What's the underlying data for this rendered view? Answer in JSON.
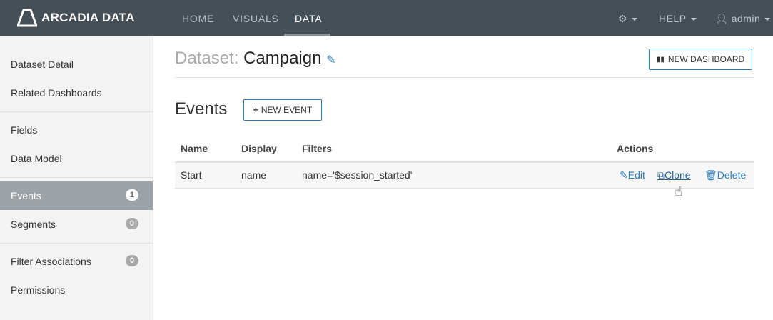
{
  "brand": "ARCADIA DATA",
  "nav": [
    "HOME",
    "VISUALS",
    "DATA"
  ],
  "right": {
    "help": "HELP",
    "user": "admin"
  },
  "sidebar": [
    {
      "label": "Dataset Detail"
    },
    {
      "label": "Related Dashboards"
    },
    {
      "label": "Fields"
    },
    {
      "label": "Data Model"
    },
    {
      "label": "Events",
      "badge": "1"
    },
    {
      "label": "Segments",
      "badge": "0"
    },
    {
      "label": "Filter Associations",
      "badge": "0"
    },
    {
      "label": "Permissions"
    }
  ],
  "page": {
    "prefix": "Dataset:",
    "name": "Campaign",
    "new_dashboard": "NEW DASHBOARD",
    "section": "Events",
    "new_event": "NEW EVENT"
  },
  "table": {
    "headers": [
      "Name",
      "Display",
      "Filters",
      "Actions"
    ],
    "rows": [
      {
        "name": "Start",
        "display": "name",
        "filters": "name='$session_started'",
        "actions": [
          "Edit",
          "Clone",
          "Delete"
        ]
      }
    ]
  }
}
